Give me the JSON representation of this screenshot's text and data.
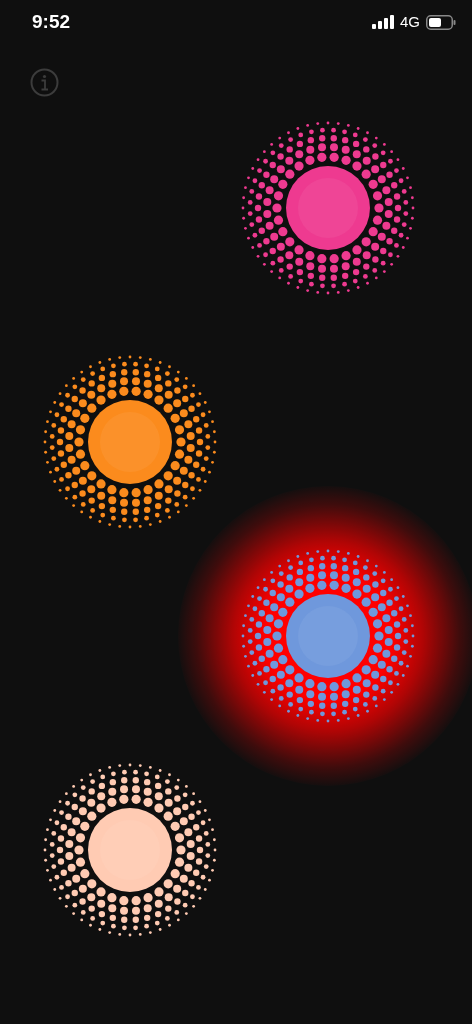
{
  "status_bar": {
    "time": "9:52",
    "network": "4G"
  },
  "orbs": [
    {
      "color": "#ee3a90",
      "glow": false
    },
    {
      "color": "#fb8b1d",
      "glow": false
    },
    {
      "color": "#6f98dc",
      "glow": true
    },
    {
      "color": "#ffcbb3",
      "glow": false
    }
  ]
}
